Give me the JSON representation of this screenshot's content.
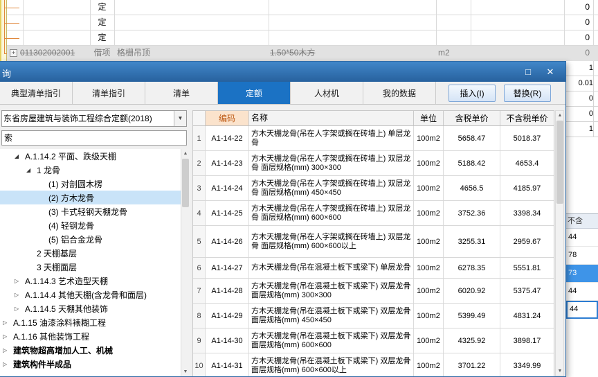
{
  "background": {
    "grid_rows": [
      {
        "category": "定",
        "value": "0"
      },
      {
        "category": "定",
        "value": "0"
      },
      {
        "category": "定",
        "value": "0"
      }
    ],
    "disabled_row": {
      "expand": "+",
      "code": "011302002001",
      "category": "借项",
      "name": "格栅吊顶",
      "spec": "1.50*50木方",
      "unit": "m2",
      "value": "0"
    },
    "right_panel": {
      "cells": [
        "1",
        "0.01",
        "0",
        "0",
        "1"
      ],
      "lower_header": "不含",
      "lower_cells": [
        {
          "value": "44",
          "state": "normal"
        },
        {
          "value": "78",
          "state": "normal"
        },
        {
          "value": "73",
          "state": "selected"
        },
        {
          "value": "44",
          "state": "normal"
        },
        {
          "value": "44",
          "state": "active"
        }
      ]
    }
  },
  "dialog": {
    "title": "询",
    "window_buttons": {
      "maximize": "□",
      "close": "✕"
    },
    "tabs": [
      {
        "label": "典型清单指引",
        "selected": false
      },
      {
        "label": "清单指引",
        "selected": false
      },
      {
        "label": "清单",
        "selected": false
      },
      {
        "label": "定额",
        "selected": true
      },
      {
        "label": "人材机",
        "selected": false
      },
      {
        "label": "我的数据",
        "selected": false
      }
    ],
    "buttons": {
      "insert": "插入(I)",
      "replace": "替换(R)"
    },
    "left_panel": {
      "combo_value": "东省房屋建筑与装饰工程综合定额(2018)",
      "search_value": "索",
      "tree": [
        {
          "label": "A.1.14.2 平面、跌级天棚",
          "indent": 1,
          "arrow": "expanded",
          "selected": false,
          "bold": false
        },
        {
          "label": "1 龙骨",
          "indent": 2,
          "arrow": "expanded",
          "selected": false,
          "bold": false
        },
        {
          "label": "(1) 对剖圆木楞",
          "indent": 3,
          "arrow": "none",
          "selected": false,
          "bold": false
        },
        {
          "label": "(2) 方木龙骨",
          "indent": 3,
          "arrow": "none",
          "selected": true,
          "bold": false
        },
        {
          "label": "(3) 卡式轻钢天棚龙骨",
          "indent": 3,
          "arrow": "none",
          "selected": false,
          "bold": false
        },
        {
          "label": "(4) 轻钢龙骨",
          "indent": 3,
          "arrow": "none",
          "selected": false,
          "bold": false
        },
        {
          "label": "(5) 铝合金龙骨",
          "indent": 3,
          "arrow": "none",
          "selected": false,
          "bold": false
        },
        {
          "label": "2 天棚基层",
          "indent": 2,
          "arrow": "none",
          "selected": false,
          "bold": false
        },
        {
          "label": "3 天棚面层",
          "indent": 2,
          "arrow": "none",
          "selected": false,
          "bold": false
        },
        {
          "label": "A.1.14.3 艺术造型天棚",
          "indent": 1,
          "arrow": "collapsed",
          "selected": false,
          "bold": false
        },
        {
          "label": "A.1.14.4 其他天棚(含龙骨和面层)",
          "indent": 1,
          "arrow": "collapsed",
          "selected": false,
          "bold": false
        },
        {
          "label": "A.1.14.5 天棚其他装饰",
          "indent": 1,
          "arrow": "collapsed",
          "selected": false,
          "bold": false
        },
        {
          "label": "A.1.15 油漆涂料裱糊工程",
          "indent": 0,
          "arrow": "collapsed",
          "selected": false,
          "bold": false
        },
        {
          "label": "A.1.16 其他装饰工程",
          "indent": 0,
          "arrow": "collapsed",
          "selected": false,
          "bold": false
        },
        {
          "label": "建筑物超高增加人工、机械",
          "indent": 0,
          "arrow": "collapsed",
          "selected": false,
          "bold": true
        },
        {
          "label": "建筑构件半成品",
          "indent": 0,
          "arrow": "collapsed",
          "selected": false,
          "bold": true
        }
      ]
    },
    "table": {
      "headers": {
        "code": "编码",
        "name": "名称",
        "unit": "单位",
        "price_tax": "含税单价",
        "price_notax": "不含税单价"
      },
      "rows": [
        {
          "num": "1",
          "code": "A1-14-22",
          "name": "方木天棚龙骨(吊在人字架或搁在砖墙上) 单层龙骨",
          "unit": "100m2",
          "price_tax": "5658.47",
          "price_notax": "5018.37"
        },
        {
          "num": "2",
          "code": "A1-14-23",
          "name": "方木天棚龙骨(吊在人字架或搁在砖墙上) 双层龙骨 面层规格(mm) 300×300",
          "unit": "100m2",
          "price_tax": "5188.42",
          "price_notax": "4653.4"
        },
        {
          "num": "3",
          "code": "A1-14-24",
          "name": "方木天棚龙骨(吊在人字架或搁在砖墙上) 双层龙骨 面层规格(mm) 450×450",
          "unit": "100m2",
          "price_tax": "4656.5",
          "price_notax": "4185.97"
        },
        {
          "num": "4",
          "code": "A1-14-25",
          "name": "方木天棚龙骨(吊在人字架或搁在砖墙上) 双层龙骨 面层规格(mm) 600×600",
          "unit": "100m2",
          "price_tax": "3752.36",
          "price_notax": "3398.34"
        },
        {
          "num": "5",
          "code": "A1-14-26",
          "name": "方木天棚龙骨(吊在人字架或搁在砖墙上) 双层龙骨 面层规格(mm) 600×600以上",
          "unit": "100m2",
          "price_tax": "3255.31",
          "price_notax": "2959.67"
        },
        {
          "num": "6",
          "code": "A1-14-27",
          "name": "方木天棚龙骨(吊在混凝土板下或梁下) 单层龙骨",
          "unit": "100m2",
          "price_tax": "6278.35",
          "price_notax": "5551.81"
        },
        {
          "num": "7",
          "code": "A1-14-28",
          "name": "方木天棚龙骨(吊在混凝土板下或梁下) 双层龙骨 面层规格(mm) 300×300",
          "unit": "100m2",
          "price_tax": "6020.92",
          "price_notax": "5375.47"
        },
        {
          "num": "8",
          "code": "A1-14-29",
          "name": "方木天棚龙骨(吊在混凝土板下或梁下) 双层龙骨 面层规格(mm) 450×450",
          "unit": "100m2",
          "price_tax": "5399.49",
          "price_notax": "4831.24"
        },
        {
          "num": "9",
          "code": "A1-14-30",
          "name": "方木天棚龙骨(吊在混凝土板下或梁下) 双层龙骨 面层规格(mm) 600×600",
          "unit": "100m2",
          "price_tax": "4325.92",
          "price_notax": "3898.17"
        },
        {
          "num": "10",
          "code": "A1-14-31",
          "name": "方木天棚龙骨(吊在混凝土板下或梁下) 双层龙骨 面层规格(mm) 600×600以上",
          "unit": "100m2",
          "price_tax": "3701.22",
          "price_notax": "3349.99"
        }
      ]
    }
  }
}
